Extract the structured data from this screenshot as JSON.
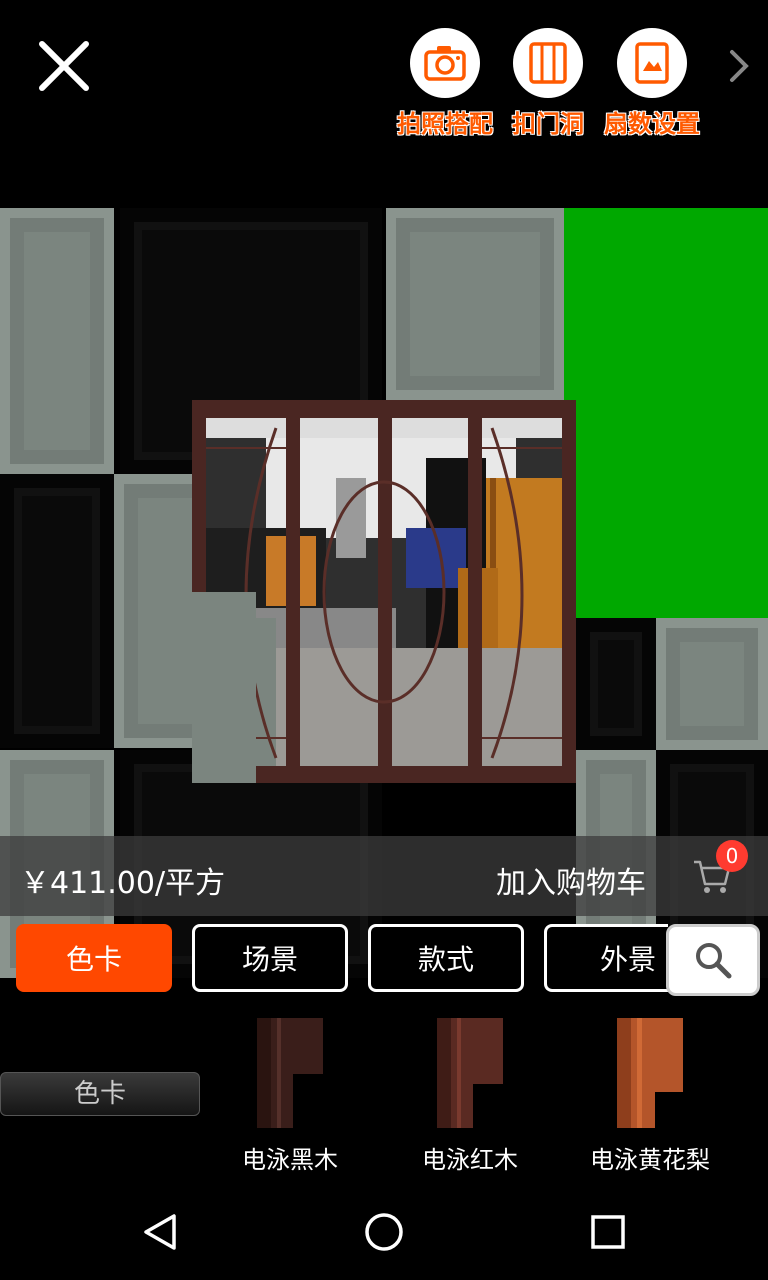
{
  "toolbar": {
    "photo_match_label": "拍照搭配",
    "door_hole_label": "扣门洞",
    "panel_count_label": "扇数设置",
    "close_icon": "close-icon",
    "next_icon": "chevron-right-icon"
  },
  "product": {
    "price": "￥411.00/平方",
    "add_to_cart": "加入购物车",
    "cart_count": "0"
  },
  "tabs": [
    {
      "label": "色卡",
      "active": true
    },
    {
      "label": "场景",
      "active": false
    },
    {
      "label": "款式",
      "active": false
    },
    {
      "label": "外景",
      "active": false
    }
  ],
  "category": {
    "button_label": "色卡"
  },
  "swatches": [
    {
      "name": "电泳黑木",
      "color": "#3a1e1a"
    },
    {
      "name": "电泳红木",
      "color": "#5a2a22"
    },
    {
      "name": "电泳黄花梨",
      "color": "#b4552a"
    }
  ],
  "colors": {
    "accent": "#ff4800",
    "badge": "#ff3b30",
    "green_tile": "#00a800"
  }
}
